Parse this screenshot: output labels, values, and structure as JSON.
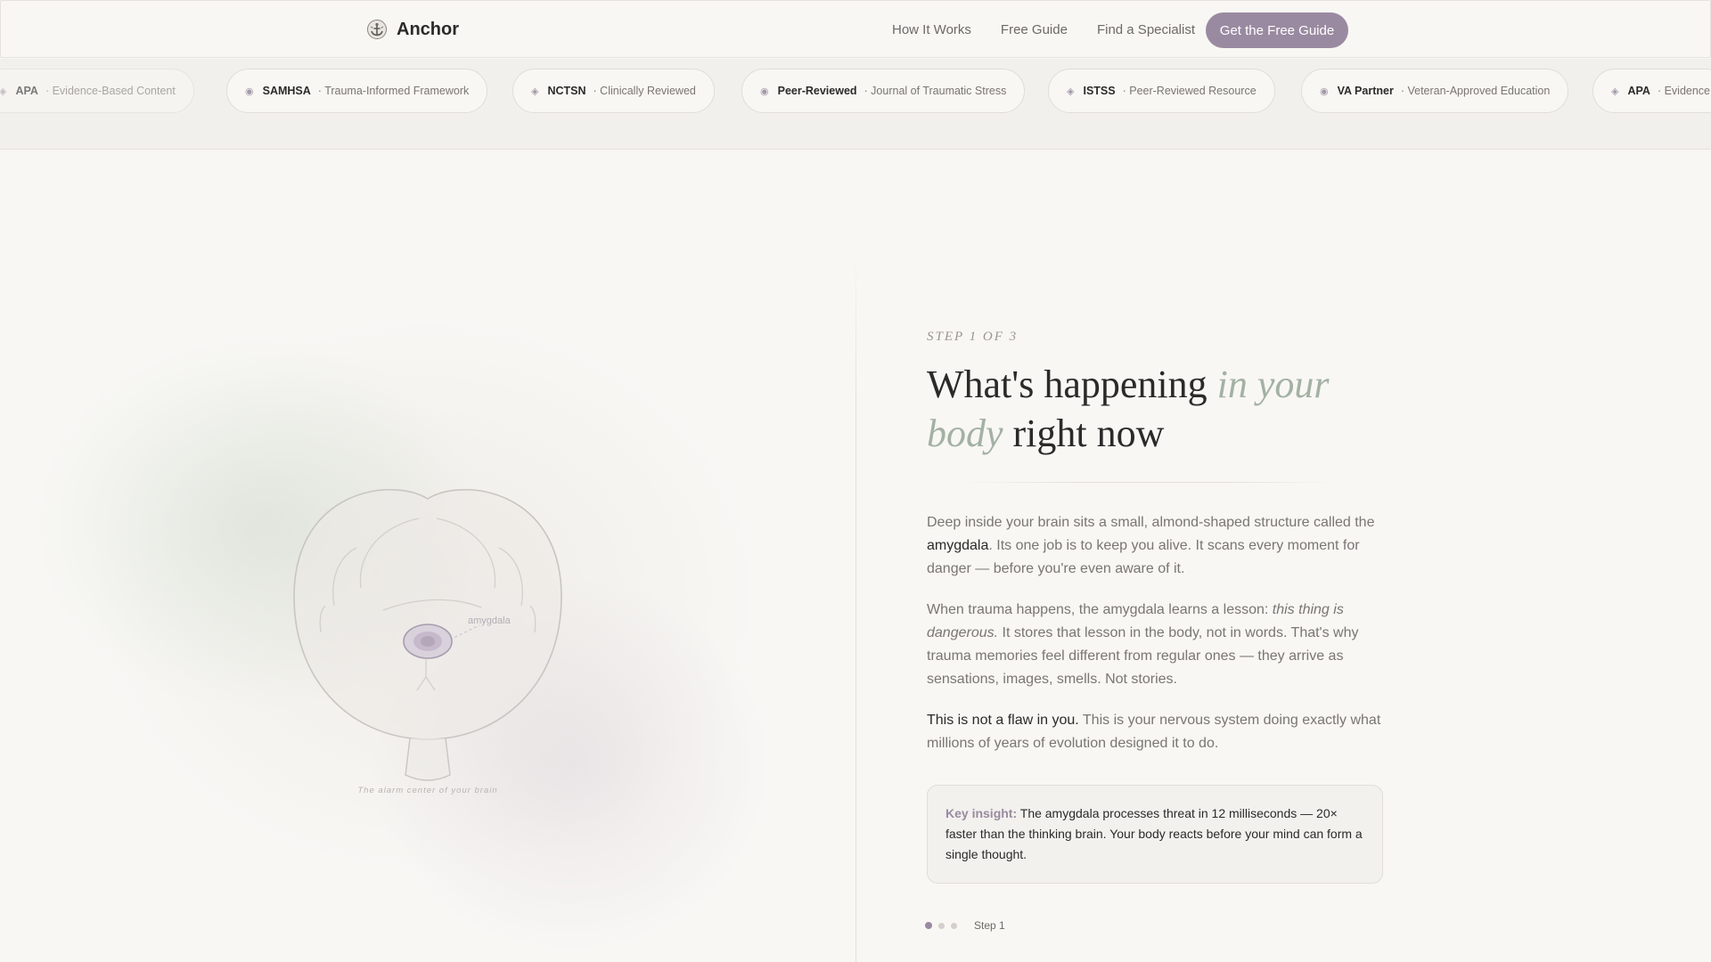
{
  "header": {
    "brand": "Anchor",
    "nav": [
      "How It Works",
      "Free Guide",
      "Find a Specialist"
    ],
    "cta": "Get the Free Guide"
  },
  "trust_bar": {
    "items": [
      {
        "name": "APA",
        "desc": "· Evidence-Based Content"
      },
      {
        "name": "SAMHSA",
        "desc": "· Trauma-Informed Framework"
      },
      {
        "name": "NCTSN",
        "desc": "· Clinically Reviewed"
      },
      {
        "name": "Peer-Reviewed",
        "desc": "· Journal of Traumatic Stress"
      },
      {
        "name": "ISTSS",
        "desc": "· Peer-Reviewed Resource"
      },
      {
        "name": "VA Partner",
        "desc": "· Veteran-Approved Education"
      },
      {
        "name": "APA",
        "desc": "· Evidence"
      }
    ]
  },
  "illustration": {
    "label": "amygdala",
    "caption": "The alarm center of your brain"
  },
  "content": {
    "step_label": "STEP 1 OF 3",
    "headline": {
      "part1": "What's happening ",
      "accent": "in your body",
      "part2": " right now"
    },
    "p1": {
      "a": "Deep inside your brain sits a small, almond-shaped structure called the ",
      "b": "amygdala",
      "c": ". Its one job is to keep you alive. It scans every moment for danger — before you're even aware of it."
    },
    "p2": {
      "a": "When trauma happens, the amygdala learns a lesson: ",
      "b": "this thing is dangerous.",
      "c": " It stores that lesson in the body, not in words. That's why trauma memories feel different from regular ones — they arrive as sensations, images, smells. Not stories."
    },
    "p3": {
      "a": "This is not a flaw in you.",
      "b": " This is your nervous system doing exactly what millions of years of evolution designed it to do."
    },
    "insight": {
      "label": "Key insight:",
      "text": " The amygdala processes threat in 12 milliseconds — 20× faster than the thinking brain. Your body reacts before your mind can form a single thought."
    },
    "progress": {
      "total_steps": 3,
      "current_step": 1,
      "label": "Step 1"
    }
  },
  "colors": {
    "accent": "#9a8aa1",
    "sage": "#a3b1a3",
    "background": "#f8f7f4",
    "text": "#2c2a28"
  }
}
